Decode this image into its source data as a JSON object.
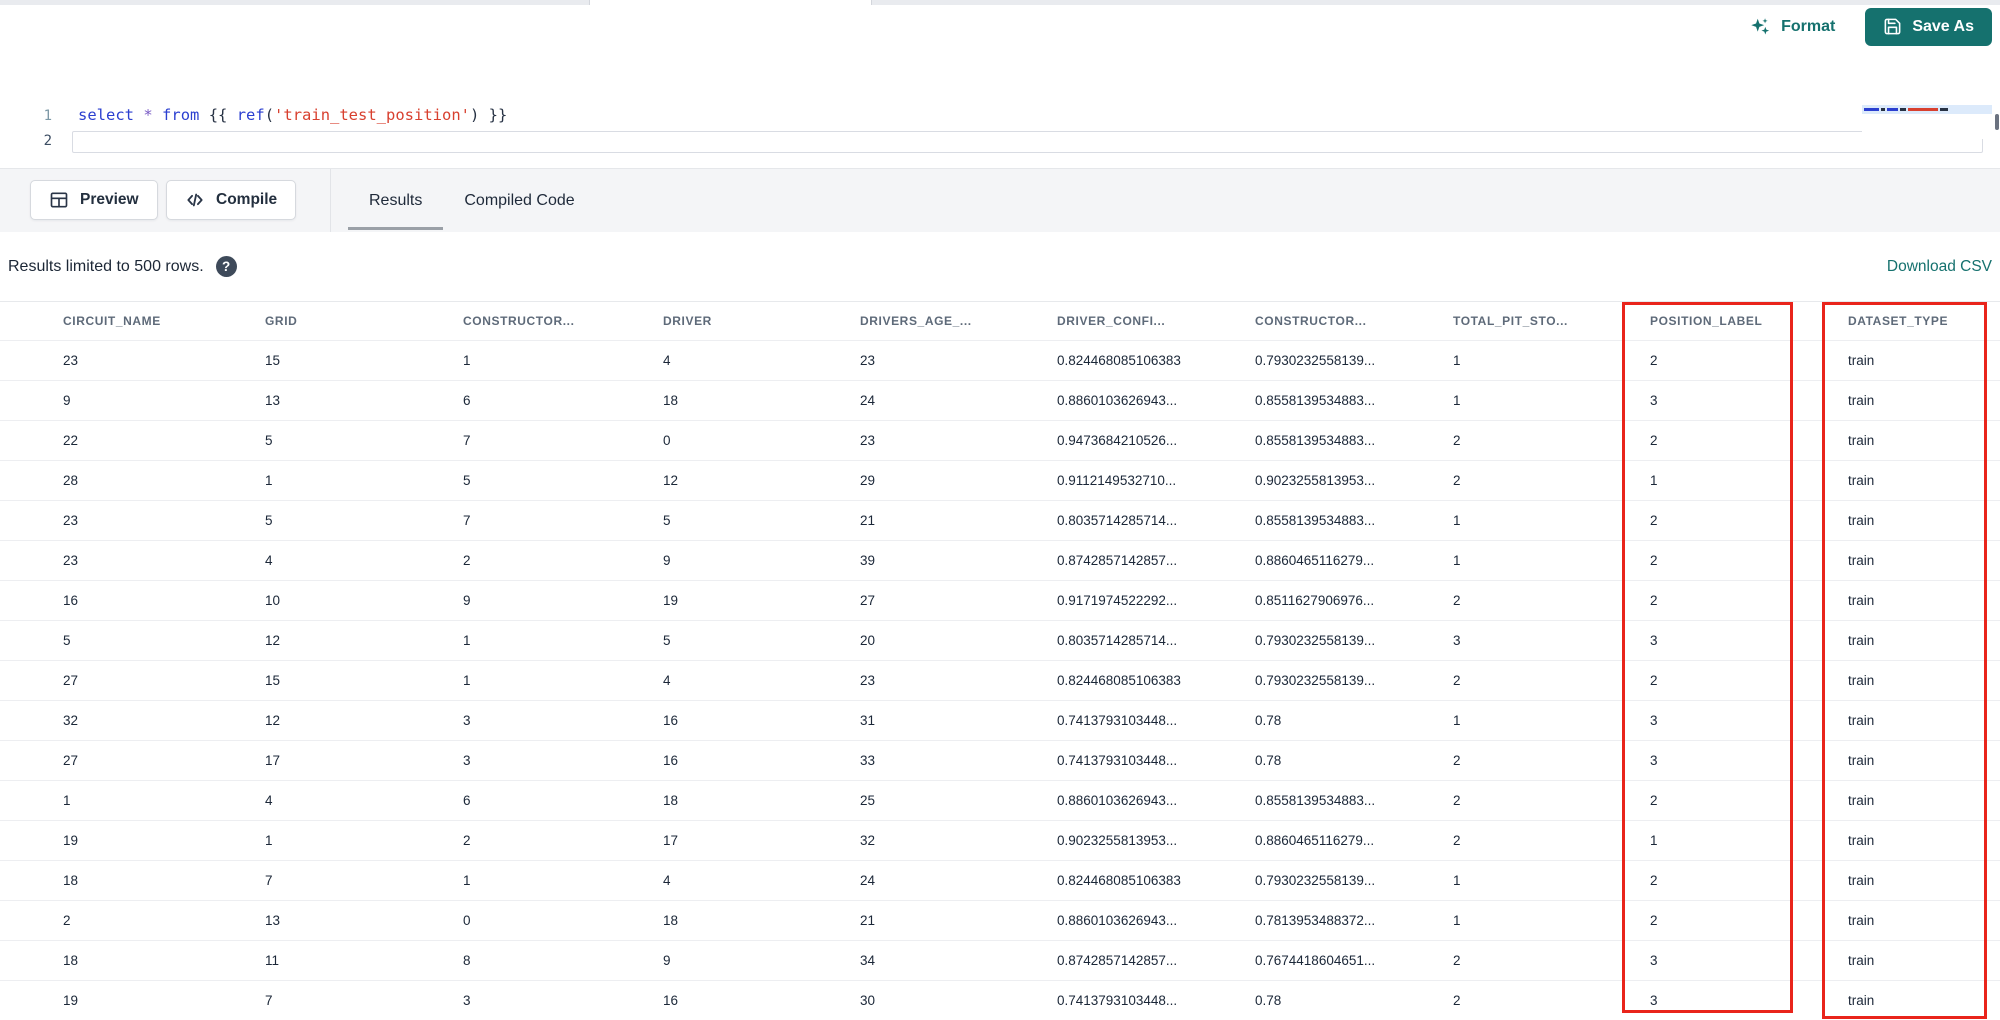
{
  "colors": {
    "accent_teal": "#15716e",
    "annotation_red": "#e9241b",
    "toolbar_bg": "#f4f5f7",
    "keyword_blue": "#2b3fd0",
    "string_red": "#d8402f"
  },
  "icons": {
    "format": "sparkles-icon",
    "save_as": "save-icon",
    "preview": "table-grid-icon",
    "compile": "code-icon",
    "help": "help-circle-icon"
  },
  "header_bar": {
    "format_label": "Format",
    "save_as_label": "Save As"
  },
  "editor": {
    "lines": [
      {
        "number": "1",
        "tokens": [
          {
            "text": "select",
            "type": "keyword"
          },
          {
            "text": " ",
            "type": "plain"
          },
          {
            "text": "*",
            "type": "operator"
          },
          {
            "text": " ",
            "type": "plain"
          },
          {
            "text": "from",
            "type": "keyword"
          },
          {
            "text": " {{ ",
            "type": "plain"
          },
          {
            "text": "ref",
            "type": "keyword"
          },
          {
            "text": "(",
            "type": "plain"
          },
          {
            "text": "'train_test_position'",
            "type": "string"
          },
          {
            "text": ")",
            "type": "plain"
          },
          {
            "text": " }}",
            "type": "plain"
          }
        ]
      },
      {
        "number": "2",
        "tokens": []
      }
    ]
  },
  "toolbar": {
    "preview_label": "Preview",
    "compile_label": "Compile",
    "tabs": [
      {
        "label": "Results",
        "active": true
      },
      {
        "label": "Compiled Code",
        "active": false
      }
    ]
  },
  "results_bar": {
    "info_text": "Results limited to 500 rows.",
    "help_glyph": "?",
    "download_label": "Download CSV"
  },
  "table": {
    "columns": [
      "CIRCUIT_NAME",
      "GRID",
      "CONSTRUCTOR...",
      "DRIVER",
      "DRIVERS_AGE_...",
      "DRIVER_CONFI...",
      "CONSTRUCTOR...",
      "TOTAL_PIT_STO...",
      "POSITION_LABEL",
      "DATASET_TYPE"
    ],
    "rows": [
      [
        "23",
        "15",
        "1",
        "4",
        "23",
        "0.824468085106383",
        "0.7930232558139...",
        "1",
        "2",
        "train"
      ],
      [
        "9",
        "13",
        "6",
        "18",
        "24",
        "0.8860103626943...",
        "0.8558139534883...",
        "1",
        "3",
        "train"
      ],
      [
        "22",
        "5",
        "7",
        "0",
        "23",
        "0.9473684210526...",
        "0.8558139534883...",
        "2",
        "2",
        "train"
      ],
      [
        "28",
        "1",
        "5",
        "12",
        "29",
        "0.9112149532710...",
        "0.9023255813953...",
        "2",
        "1",
        "train"
      ],
      [
        "23",
        "5",
        "7",
        "5",
        "21",
        "0.8035714285714...",
        "0.8558139534883...",
        "1",
        "2",
        "train"
      ],
      [
        "23",
        "4",
        "2",
        "9",
        "39",
        "0.8742857142857...",
        "0.8860465116279...",
        "1",
        "2",
        "train"
      ],
      [
        "16",
        "10",
        "9",
        "19",
        "27",
        "0.9171974522292...",
        "0.8511627906976...",
        "2",
        "2",
        "train"
      ],
      [
        "5",
        "12",
        "1",
        "5",
        "20",
        "0.8035714285714...",
        "0.7930232558139...",
        "3",
        "3",
        "train"
      ],
      [
        "27",
        "15",
        "1",
        "4",
        "23",
        "0.824468085106383",
        "0.7930232558139...",
        "2",
        "2",
        "train"
      ],
      [
        "32",
        "12",
        "3",
        "16",
        "31",
        "0.7413793103448...",
        "0.78",
        "1",
        "3",
        "train"
      ],
      [
        "27",
        "17",
        "3",
        "16",
        "33",
        "0.7413793103448...",
        "0.78",
        "2",
        "3",
        "train"
      ],
      [
        "1",
        "4",
        "6",
        "18",
        "25",
        "0.8860103626943...",
        "0.8558139534883...",
        "2",
        "2",
        "train"
      ],
      [
        "19",
        "1",
        "2",
        "17",
        "32",
        "0.9023255813953...",
        "0.8860465116279...",
        "2",
        "1",
        "train"
      ],
      [
        "18",
        "7",
        "1",
        "4",
        "24",
        "0.824468085106383",
        "0.7930232558139...",
        "1",
        "2",
        "train"
      ],
      [
        "2",
        "13",
        "0",
        "18",
        "21",
        "0.8860103626943...",
        "0.7813953488372...",
        "1",
        "2",
        "train"
      ],
      [
        "18",
        "11",
        "8",
        "9",
        "34",
        "0.8742857142857...",
        "0.7674418604651...",
        "2",
        "3",
        "train"
      ],
      [
        "19",
        "7",
        "3",
        "16",
        "30",
        "0.7413793103448...",
        "0.78",
        "2",
        "3",
        "train"
      ]
    ]
  },
  "annotations": {
    "highlighted_columns": [
      "POSITION_LABEL",
      "DATASET_TYPE"
    ]
  }
}
